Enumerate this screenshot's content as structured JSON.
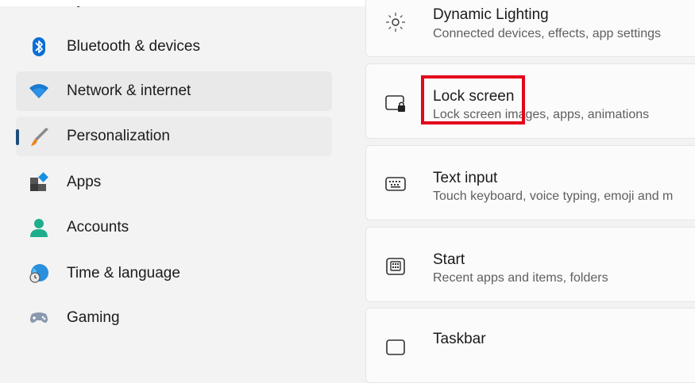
{
  "sidebar": {
    "items": [
      {
        "label": "System",
        "icon": "system-icon"
      },
      {
        "label": "Bluetooth & devices",
        "icon": "bluetooth-icon"
      },
      {
        "label": "Network & internet",
        "icon": "wifi-icon"
      },
      {
        "label": "Personalization",
        "icon": "brush-icon"
      },
      {
        "label": "Apps",
        "icon": "apps-icon"
      },
      {
        "label": "Accounts",
        "icon": "account-icon"
      },
      {
        "label": "Time & language",
        "icon": "globe-clock-icon"
      },
      {
        "label": "Gaming",
        "icon": "gamepad-icon"
      }
    ],
    "selected": "Personalization"
  },
  "settings": [
    {
      "title": "Dynamic Lighting",
      "desc": "Connected devices, effects, app settings",
      "icon": "dynamic-lighting-icon"
    },
    {
      "title": "Lock screen",
      "desc": "Lock screen images, apps, animations",
      "icon": "lock-screen-icon"
    },
    {
      "title": "Text input",
      "desc": "Touch keyboard, voice typing, emoji and m",
      "icon": "keyboard-icon"
    },
    {
      "title": "Start",
      "desc": "Recent apps and items, folders",
      "icon": "start-icon"
    },
    {
      "title": "Taskbar",
      "desc": "",
      "icon": "taskbar-icon"
    }
  ],
  "colors": {
    "accent": "#0067c0",
    "highlight": "#e3061c"
  }
}
